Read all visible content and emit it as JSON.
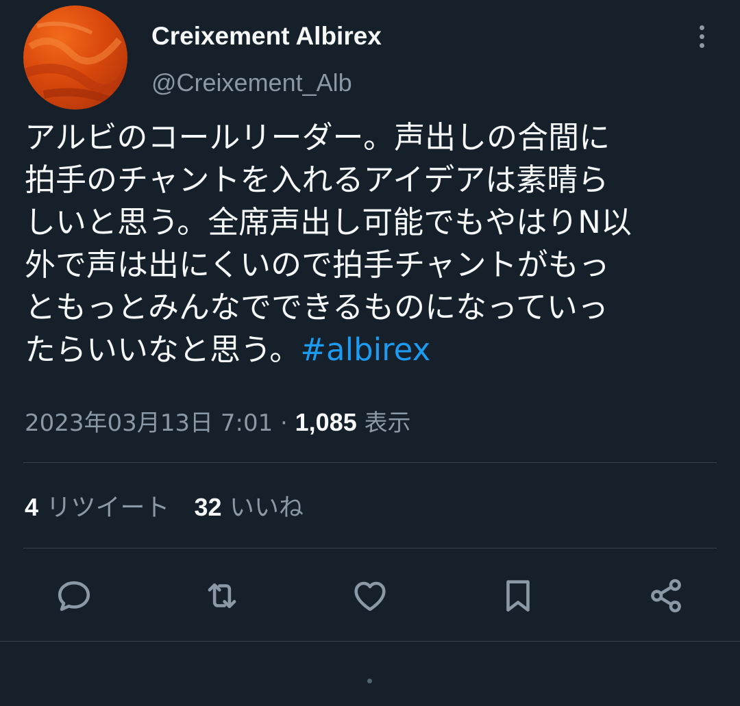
{
  "author": {
    "display_name": "Creixement Albirex",
    "handle": "@Creixement_Alb",
    "avatar_color": "#e2550f"
  },
  "tweet": {
    "lines": [
      "アルビのコールリーダー。声出しの合間に",
      "拍手のチャントを入れるアイデアは素晴ら",
      "しいと思う。全席声出し可能でもやはりN以",
      "外で声は出にくいので拍手チャントがもっ",
      "ともっとみんなでできるものになっていっ",
      "たらいいなと思う。"
    ],
    "hashtag": "#albirex"
  },
  "meta": {
    "timestamp": "2023年03月13日 7:01",
    "separator": "·",
    "views_count": "1,085",
    "views_label": "表示"
  },
  "stats": {
    "retweets_count": "4",
    "retweets_label": "リツイート",
    "likes_count": "32",
    "likes_label": "いいね"
  },
  "actions": [
    {
      "icon": "reply-icon"
    },
    {
      "icon": "retweet-icon"
    },
    {
      "icon": "like-icon"
    },
    {
      "icon": "bookmark-icon"
    },
    {
      "icon": "share-icon"
    }
  ],
  "colors": {
    "background": "#15202b",
    "text": "#f7f9f9",
    "secondary": "#8b98a5",
    "accent": "#1d9bf0",
    "divider": "#38444d"
  }
}
